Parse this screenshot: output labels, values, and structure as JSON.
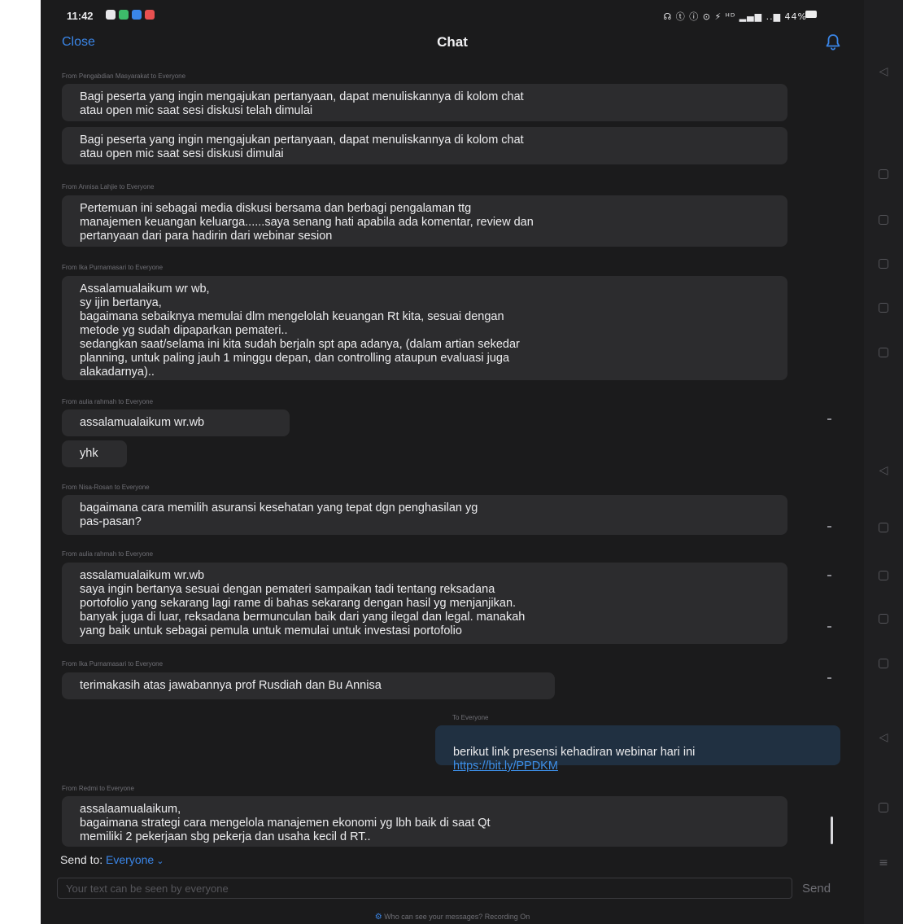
{
  "status_bar": {
    "time": "11:42",
    "indicators": "☊ ⓣ ⓘ ⊙ ⚡ ᴴᴰ ▂▄▆ ..▆ 44%"
  },
  "header": {
    "close_label": "Close",
    "title": "Chat",
    "bell_icon": "bell-icon"
  },
  "messages": [
    {
      "sender": "From Pengabdian Masyarakat to Everyone",
      "bubbles": [
        "Bagi peserta yang ingin mengajukan pertanyaan, dapat menuliskannya di kolom chat\natau open mic saat sesi diskusi telah dimulai",
        "Bagi peserta yang ingin mengajukan pertanyaan, dapat menuliskannya di kolom chat\natau open mic saat sesi diskusi dimulai"
      ]
    },
    {
      "sender": "From Annisa Lahjie to Everyone",
      "bubbles": [
        "Pertemuan ini sebagai media diskusi bersama dan berbagi pengalaman ttg\nmanajemen keuangan keluarga......saya senang hati apabila ada komentar, review dan\npertanyaan dari para hadirin dari webinar sesion"
      ]
    },
    {
      "sender": "From Ika Purnamasari to Everyone",
      "bubbles": [
        "Assalamualaikum wr wb,\nsy ijin bertanya,\nbagaimana sebaiknya memulai dlm mengelolah keuangan Rt kita, sesuai dengan\nmetode yg sudah dipaparkan pemateri..\nsedangkan saat/selama ini kita sudah berjaln spt apa adanya, (dalam artian sekedar\nplanning, untuk paling jauh 1 minggu depan, dan controlling ataupun evaluasi juga\nalakadarnya).."
      ]
    },
    {
      "sender": "From aulia rahmah to Everyone",
      "bubbles": [
        "assalamualaikum wr.wb",
        "yhk"
      ]
    },
    {
      "sender": "From Nisa-Rosan to Everyone",
      "bubbles": [
        "bagaimana cara memilih asuransi kesehatan yang tepat dgn penghasilan yg\npas-pasan?"
      ]
    },
    {
      "sender": "From aulia rahmah to Everyone",
      "bubbles": [
        "assalamualaikum wr.wb\nsaya ingin bertanya sesuai dengan pemateri sampaikan tadi tentang reksadana\nportofolio yang sekarang lagi rame di bahas sekarang dengan hasil yg menjanjikan.\nbanyak juga di luar,  reksadana bermunculan baik dari yang ilegal dan legal.  manakah\nyang baik untuk sebagai pemula untuk memulai untuk investasi portofolio"
      ]
    },
    {
      "sender": "From Ika Purnamasari to Everyone",
      "bubbles": [
        "terimakasih atas jawabannya prof Rusdiah dan Bu Annisa"
      ]
    },
    {
      "sender": "To Everyone",
      "own": true,
      "text": "berikut link presensi kehadiran webinar hari ini",
      "link": "https://bit.ly/PPDKM"
    },
    {
      "sender": "From Redmi to Everyone",
      "bubbles": [
        "assalaamualaikum,\nbagaimana strategi cara mengelola manajemen ekonomi yg lbh baik di saat Qt\nmemiliki 2 pekerjaan sbg pekerja dan usaha kecil d RT.."
      ]
    }
  ],
  "composer": {
    "send_to_label": "Send to:",
    "send_to_value": "Everyone",
    "placeholder": "Your text can be seen by everyone",
    "send_label": "Send"
  },
  "footer": {
    "note": "Who can see your messages? Recording On"
  },
  "colors": {
    "background": "#1b1b1c",
    "bubble": "#2c2c2e",
    "own_bubble": "#203041",
    "accent": "#3a86e8"
  }
}
